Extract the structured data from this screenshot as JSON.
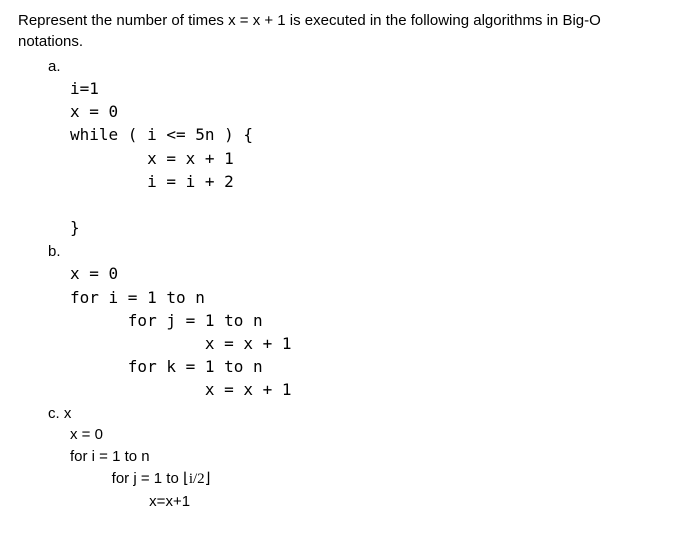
{
  "question": "Represent the number of times x = x + 1 is executed in the following algorithms in Big-O notations.",
  "parts": {
    "a": {
      "label": "a.",
      "code": "i=1\nx = 0\nwhile ( i <= 5n ) {\n        x = x + 1\n        i = i + 2\n\n}"
    },
    "b": {
      "label": "b.",
      "code": "x = 0\nfor i = 1 to n\n      for j = 1 to n\n              x = x + 1\n      for k = 1 to n\n              x = x + 1"
    },
    "c": {
      "label_line": "c.   x",
      "line1": "x = 0",
      "line2": "for i = 1 to n",
      "line3_prefix": "          for j = 1 to ",
      "line3_math": "⌊i/2⌋",
      "line4": "                   x=x+1"
    }
  }
}
